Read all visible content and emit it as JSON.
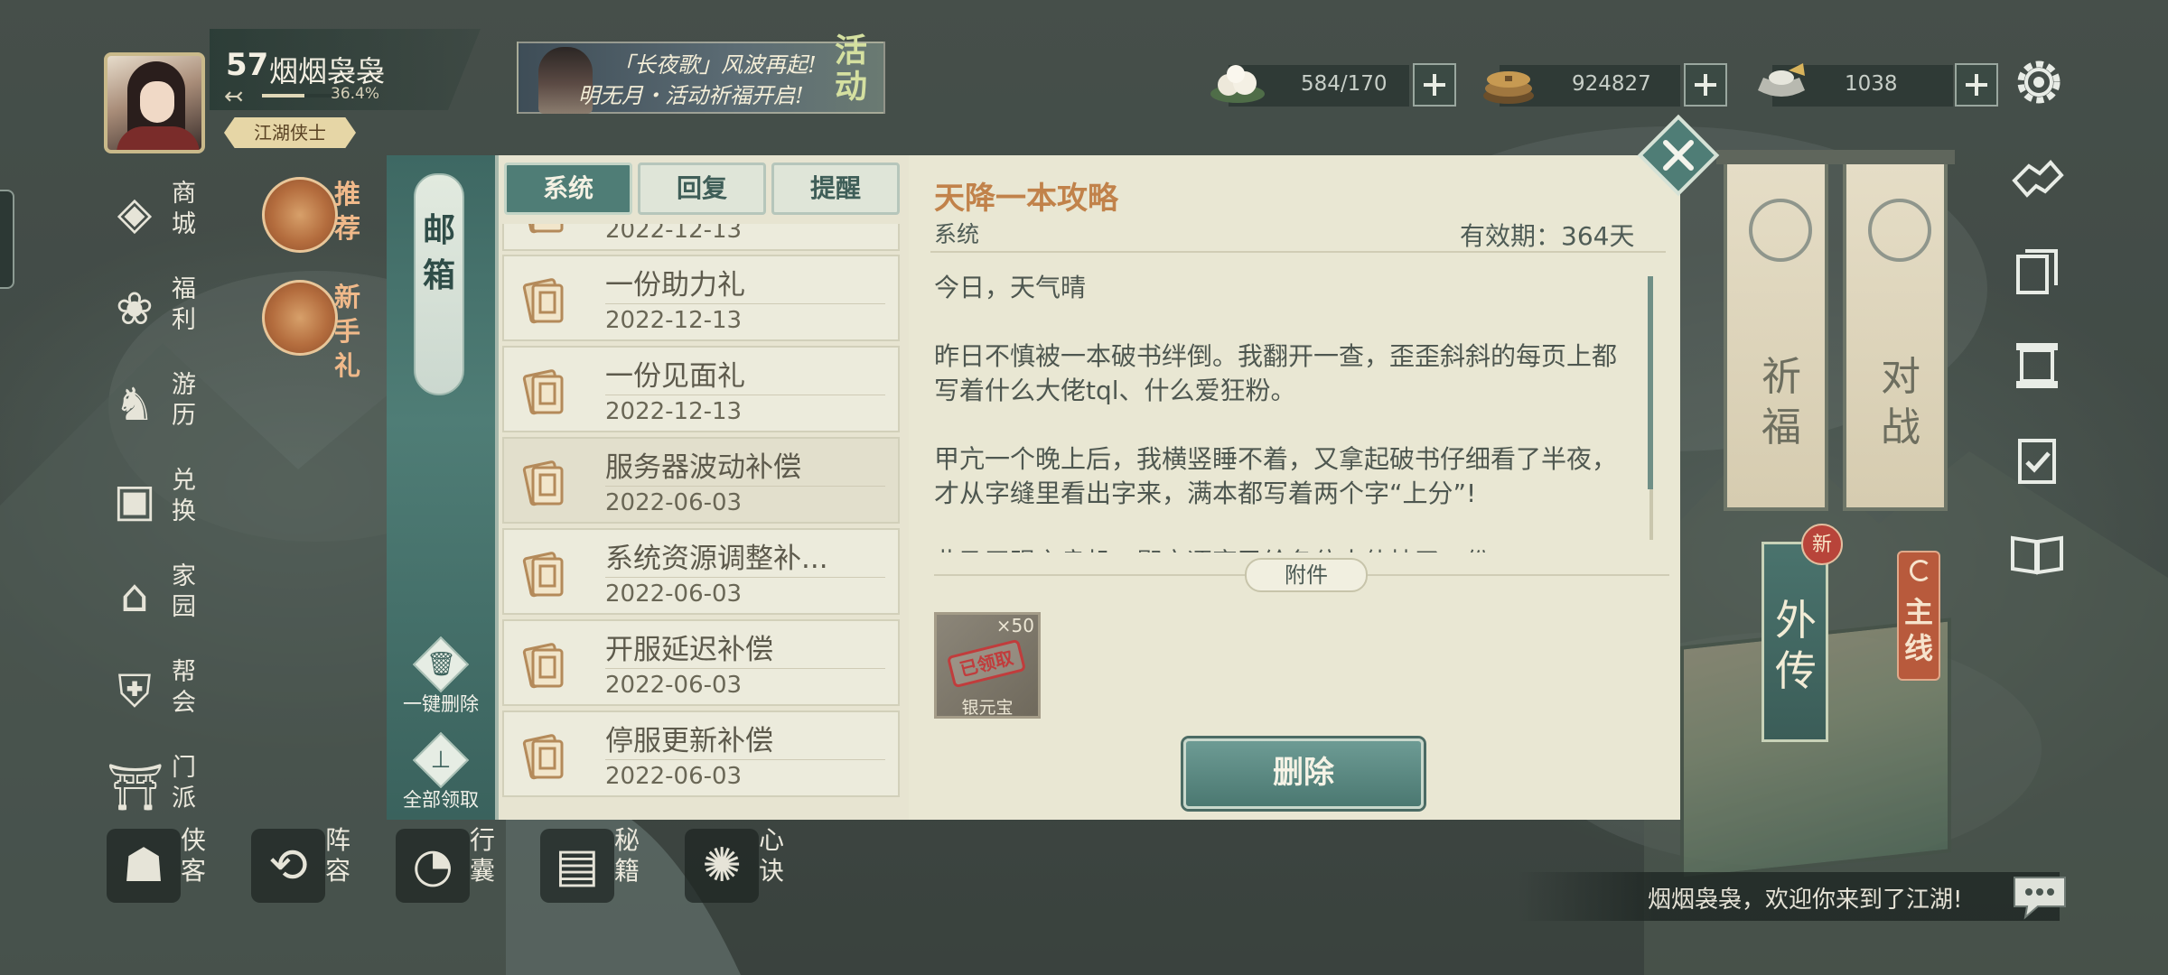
{
  "player": {
    "level": "57",
    "name": "烟烟袅袅",
    "exp_percent": "36.4%",
    "exp_fraction": 0.364,
    "title": "江湖侠士"
  },
  "banner": {
    "line1": "「长夜歌」风波再起!",
    "line2": "明无月・活动祈福开启!",
    "tag": "活动"
  },
  "currencies": [
    {
      "icon": "steamed-bun-icon",
      "value": "584/170"
    },
    {
      "icon": "coins-icon",
      "value": "924827"
    },
    {
      "icon": "silver-ingot-icon",
      "value": "1038"
    }
  ],
  "left_menu": [
    {
      "label": "商城",
      "icon": "shop-icon"
    },
    {
      "label": "福利",
      "icon": "welfare-icon"
    },
    {
      "label": "游历",
      "icon": "horse-icon"
    },
    {
      "label": "兑换",
      "icon": "exchange-icon"
    },
    {
      "label": "家园",
      "icon": "home-icon"
    },
    {
      "label": "帮会",
      "icon": "guild-icon"
    },
    {
      "label": "门派",
      "icon": "sect-icon"
    }
  ],
  "promos": [
    {
      "label": "推荐",
      "icon": "lotus-icon"
    },
    {
      "label": "新手礼",
      "icon": "snowflake-icon"
    }
  ],
  "bottom_menu": [
    {
      "label": "侠客",
      "icon": "hero-icon"
    },
    {
      "label": "阵容",
      "icon": "formation-icon"
    },
    {
      "label": "行囊",
      "icon": "bag-icon"
    },
    {
      "label": "秘籍",
      "icon": "book-icon"
    },
    {
      "label": "心诀",
      "icon": "flame-icon"
    }
  ],
  "right_scrolls": [
    {
      "label": "祈福"
    },
    {
      "label": "对战"
    }
  ],
  "waizhuan": {
    "label": "外传",
    "badge": "新"
  },
  "zhuxian": {
    "label": "主线"
  },
  "chat": {
    "text": "烟烟袅袅，欢迎你来到了江湖!"
  },
  "mailbox": {
    "title": "邮箱",
    "tabs": [
      "系统",
      "回复",
      "提醒"
    ],
    "active_tab": "系统",
    "batch_delete": "一键删除",
    "claim_all": "全部领取",
    "partial_top_date": "2022-12-13",
    "items": [
      {
        "name": "一份助力礼",
        "date": "2022-12-13",
        "read": false
      },
      {
        "name": "一份见面礼",
        "date": "2022-12-13",
        "read": false
      },
      {
        "name": "服务器波动补偿",
        "date": "2022-06-03",
        "read": true
      },
      {
        "name": "系统资源调整补...",
        "date": "2022-06-03",
        "read": false
      },
      {
        "name": "开服延迟补偿",
        "date": "2022-06-03",
        "read": false
      },
      {
        "name": "停服更新补偿",
        "date": "2022-06-03",
        "read": false
      }
    ],
    "detail": {
      "title": "天降一本攻略",
      "sender": "系统",
      "validity": "有效期：364天",
      "paragraphs": [
        "今日，天气晴",
        "昨日不慎被一本破书绊倒。我翻开一查，歪歪斜斜的每页上都写着什么大佬tql、什么爱狂粉。",
        "甲亢一个晚上后，我横竖睡不着，又拿起破书仔细看了半夜，才从字缝里看出字来，满本都写着两个字“上分”!",
        "此乃天赐之良机，鄙宝逐变已给各位大侠抄了一份"
      ],
      "attachment_label": "附件",
      "attachment": {
        "name": "银元宝",
        "quantity": "×50",
        "stamp": "已领取"
      },
      "delete_label": "删除"
    }
  },
  "colors": {
    "accent_teal": "#4f7d76",
    "title_orange": "#c1824a",
    "panel_bg": "#e9e7d3",
    "stamp_red": "#c13c3c"
  }
}
